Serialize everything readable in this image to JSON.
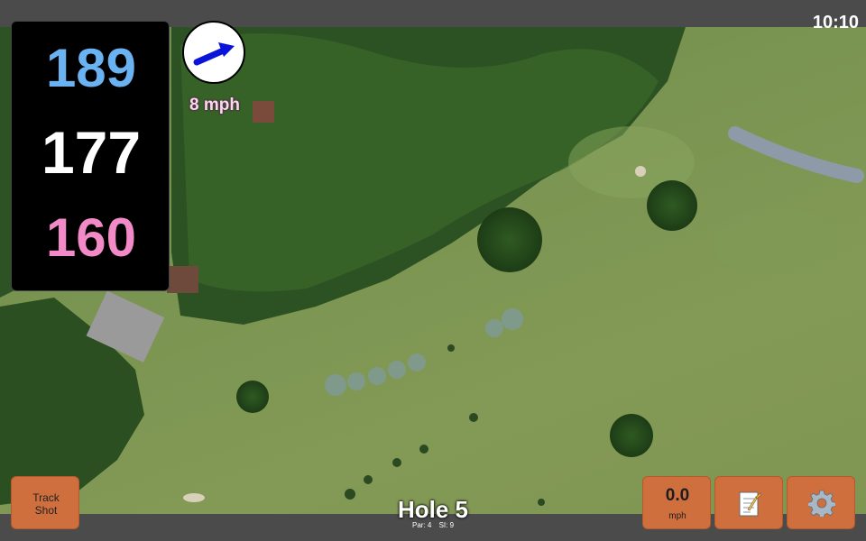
{
  "status": {
    "time": "10:10"
  },
  "distances": {
    "back": "189",
    "middle": "177",
    "front": "160"
  },
  "wind": {
    "speed": "8 mph",
    "direction_icon": "arrow-right-icon"
  },
  "hole": {
    "title": "Hole 5",
    "par": "Par: 4",
    "si": "SI: 9"
  },
  "buttons": {
    "track_shot_line1": "Track",
    "track_shot_line2": "Shot",
    "speed_value": "0.0",
    "speed_unit": "mph",
    "notes_icon": "notepad-icon",
    "settings_icon": "gear-icon"
  },
  "colors": {
    "back": "#6ab2f2",
    "middle": "#ffffff",
    "front": "#f28ac8",
    "button": "#d06f3e"
  }
}
